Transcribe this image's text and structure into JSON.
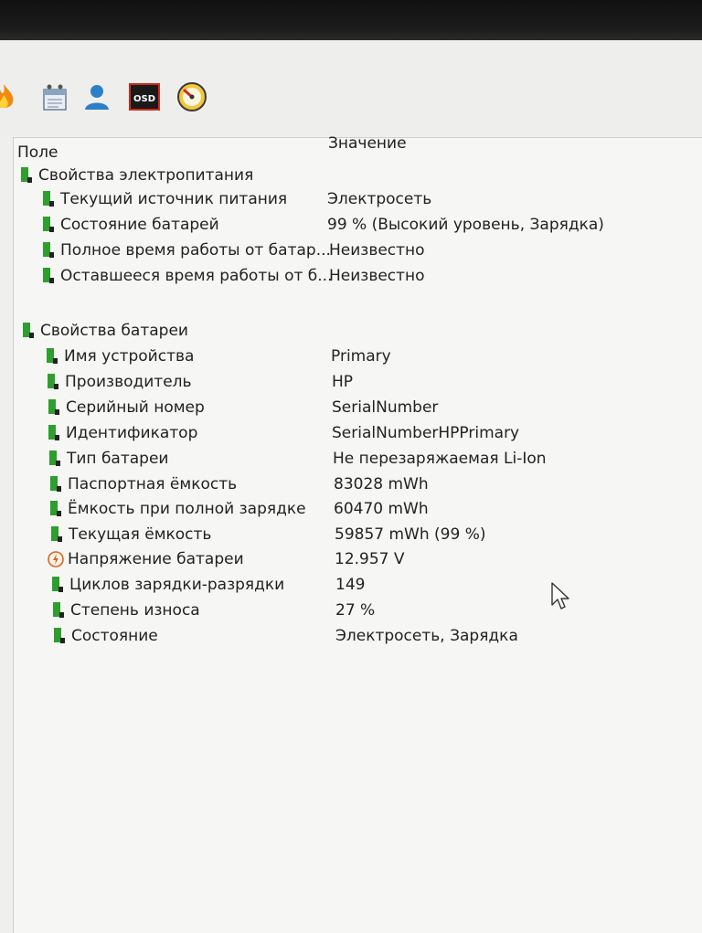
{
  "toolbar": {
    "icons": [
      "flame-icon",
      "scheduler-icon",
      "user-icon",
      "osd-icon",
      "gauge-icon"
    ],
    "osd_label": "OSD"
  },
  "columns": {
    "field": "Поле",
    "value": "Значение"
  },
  "power_section": {
    "title": "Свойства электропитания",
    "items": [
      {
        "field": "Текущий источник питания",
        "value": "Электросеть"
      },
      {
        "field": "Состояние батарей",
        "value": "99 % (Высокий уровень, Зарядка)"
      },
      {
        "field": "Полное время работы от батар...",
        "value": "Неизвестно"
      },
      {
        "field": "Оставшееся время работы от б...",
        "value": "Неизвестно"
      }
    ]
  },
  "battery_section": {
    "title": "Свойства батареи",
    "items": [
      {
        "field": "Имя устройства",
        "value": "Primary",
        "icon": "battery-icon"
      },
      {
        "field": "Производитель",
        "value": "HP",
        "icon": "battery-icon"
      },
      {
        "field": "Серийный номер",
        "value": "SerialNumber",
        "icon": "battery-icon"
      },
      {
        "field": "Идентификатор",
        "value": "SerialNumberHPPrimary",
        "icon": "battery-icon"
      },
      {
        "field": "Тип батареи",
        "value": "Не перезаряжаемая Li-Ion",
        "icon": "battery-icon"
      },
      {
        "field": "Паспортная ёмкость",
        "value": "83028 mWh",
        "icon": "battery-icon"
      },
      {
        "field": "Ёмкость при полной зарядке",
        "value": "60470 mWh",
        "icon": "battery-icon"
      },
      {
        "field": "Текущая ёмкость",
        "value": "59857 mWh  (99 %)",
        "icon": "battery-icon"
      },
      {
        "field": "Напряжение батареи",
        "value": "12.957 V",
        "icon": "voltage-icon"
      },
      {
        "field": "Циклов зарядки-разрядки",
        "value": "149",
        "icon": "battery-icon"
      },
      {
        "field": "Степень износа",
        "value": "27 %",
        "icon": "battery-icon"
      },
      {
        "field": "Состояние",
        "value": "Электросеть, Зарядка",
        "icon": "battery-icon"
      }
    ]
  },
  "colors": {
    "battery_green": "#2e9e2e",
    "voltage_orange": "#e0641a"
  }
}
